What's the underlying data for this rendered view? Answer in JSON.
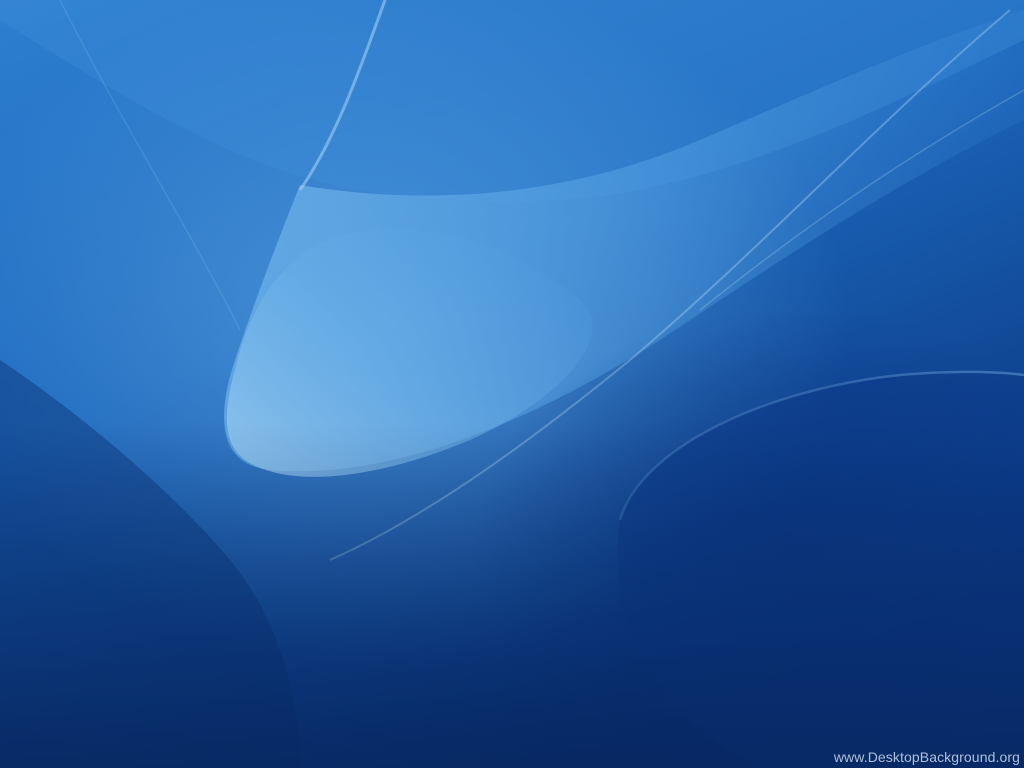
{
  "watermark": {
    "text": "www.DesktopBackground.org"
  },
  "colors": {
    "base_dark": "#0a3478",
    "base_mid": "#1559b0",
    "base_light": "#2f7fcf",
    "highlight": "#8ec6ef"
  }
}
